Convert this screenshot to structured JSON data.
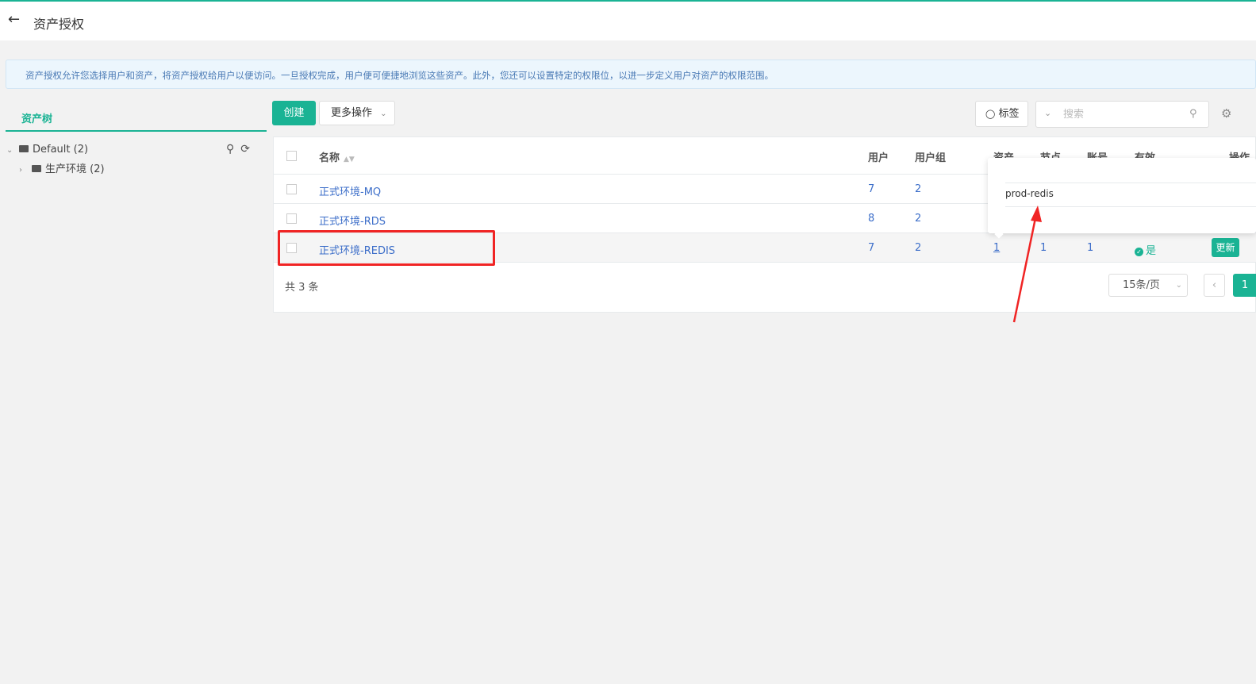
{
  "header": {
    "back_icon": "arrow-left-icon",
    "title": "资产授权"
  },
  "notice": {
    "text": "资产授权允许您选择用户和资产，将资产授权给用户以便访问。一旦授权完成，用户便可便捷地浏览这些资产。此外，您还可以设置特定的权限位，以进一步定义用户对资产的权限范围。"
  },
  "tree": {
    "tab_label": "资产树",
    "root_label": "Default (2)",
    "child_label": "生产环境 (2)",
    "search_icon": "search-icon",
    "refresh_icon": "refresh-icon"
  },
  "toolbar": {
    "create_label": "创建",
    "more_label": "更多操作",
    "tag_label": "标签",
    "search_placeholder": "搜索"
  },
  "table": {
    "headers": {
      "name": "名称",
      "users": "用户",
      "user_groups": "用户组",
      "assets": "资产",
      "nodes": "节点",
      "accounts": "账号",
      "active": "有效",
      "actions": "操作"
    },
    "rows": [
      {
        "name": "正式环境-MQ",
        "users": "7",
        "user_groups": "2"
      },
      {
        "name": "正式环境-RDS",
        "users": "8",
        "user_groups": "2"
      },
      {
        "name": "正式环境-REDIS",
        "users": "7",
        "user_groups": "2",
        "assets": "1",
        "nodes": "1",
        "accounts": "1",
        "active": "是",
        "action": "更新"
      }
    ],
    "total": "共 3 条",
    "page_size": "15条/页",
    "current_page": "1"
  },
  "popover": {
    "text": "prod-redis"
  },
  "colors": {
    "accent": "#1ab394",
    "link": "#3c6ec9",
    "annotation": "#f02424"
  }
}
